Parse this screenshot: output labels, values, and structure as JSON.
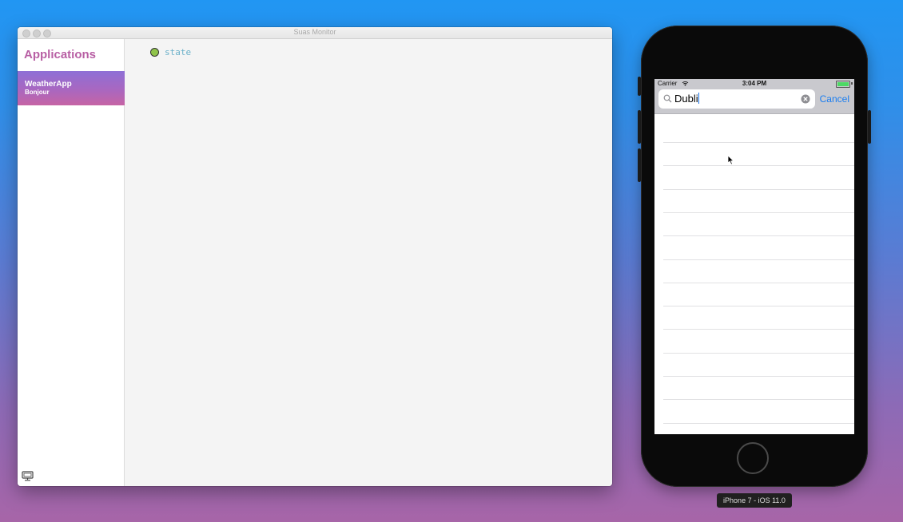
{
  "window": {
    "title": "Suas Monitor"
  },
  "sidebar": {
    "heading": "Applications",
    "apps": [
      {
        "name": "WeatherApp",
        "subtitle": "Bonjour"
      }
    ],
    "footer_icon": "monitor-icon"
  },
  "main": {
    "tree": [
      {
        "label": "state",
        "dot_color": "#8fc34a"
      }
    ]
  },
  "phone": {
    "status": {
      "carrier": "Carrier",
      "time": "3:04 PM",
      "icons": [
        "wifi-icon",
        "battery-icon"
      ]
    },
    "search": {
      "value": "Dubli",
      "placeholder": "",
      "cancel_label": "Cancel",
      "icons": [
        "search-icon",
        "clear-icon"
      ]
    },
    "empty_rows": 13
  },
  "simulator_label": "iPhone 7 - iOS 11.0",
  "colors": {
    "accent_pink": "#b85fa4",
    "ios_blue": "#1a7df0",
    "state_green": "#8fc34a"
  }
}
